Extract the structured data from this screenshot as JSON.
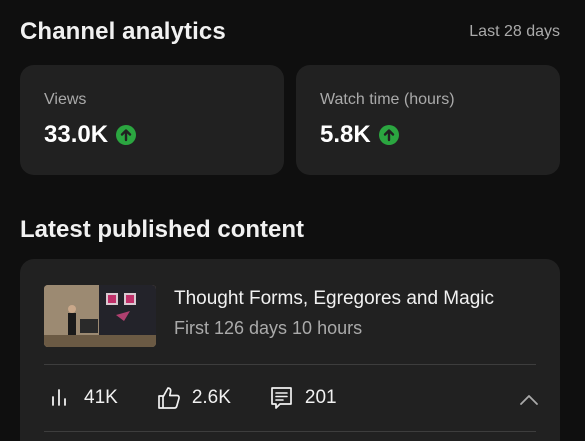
{
  "header": {
    "title": "Channel analytics",
    "period": "Last 28 days"
  },
  "stats": [
    {
      "label": "Views",
      "value": "33.0K",
      "trend": "up"
    },
    {
      "label": "Watch time (hours)",
      "value": "5.8K",
      "trend": "up"
    }
  ],
  "latest": {
    "section_title": "Latest published content",
    "video": {
      "title": "Thought Forms, Egregores and Magic",
      "subtitle": "First 126 days 10 hours",
      "views": "41K",
      "likes": "2.6K",
      "comments": "201"
    }
  },
  "colors": {
    "trend_up": "#2ba640",
    "background": "#0f0f0f",
    "card": "#212121"
  }
}
